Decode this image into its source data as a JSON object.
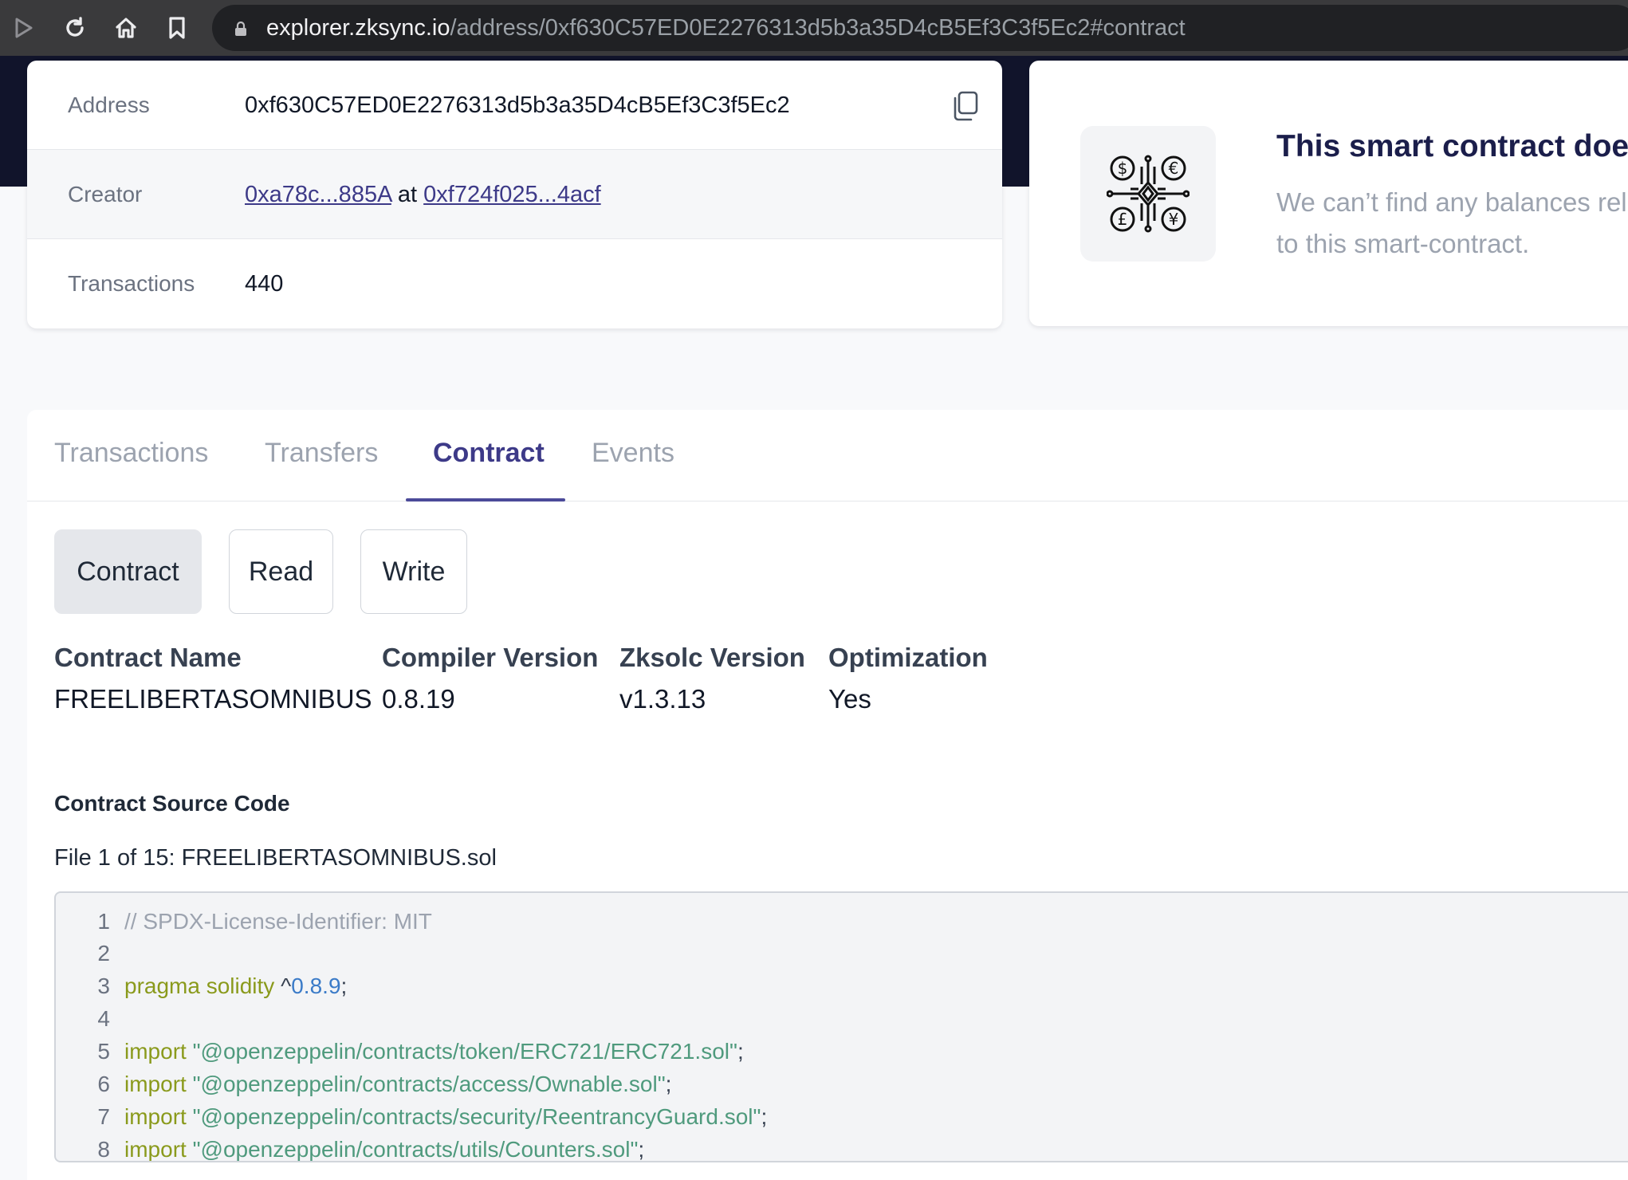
{
  "browser": {
    "url_host": "explorer.zksync.io",
    "url_path": "/address/0xf630C57ED0E2276313d5b3a35D4cB5Ef3C3f5Ec2#contract"
  },
  "info": {
    "address_label": "Address",
    "address_value": "0xf630C57ED0E2276313d5b3a35D4cB5Ef3C3f5Ec2",
    "creator_label": "Creator",
    "creator_link": "0xa78c...885A",
    "creator_at": "at",
    "creator_tx": "0xf724f025...4acf",
    "transactions_label": "Transactions",
    "transactions_value": "440"
  },
  "balances": {
    "title": "This smart contract doesn",
    "subtitle_line1": "We can’t find any balances rel",
    "subtitle_line2": "to this smart-contract."
  },
  "tabs": [
    {
      "label": "Transactions"
    },
    {
      "label": "Transfers"
    },
    {
      "label": "Contract"
    },
    {
      "label": "Events"
    }
  ],
  "active_tab": "Contract",
  "subtabs": [
    {
      "label": "Contract"
    },
    {
      "label": "Read"
    },
    {
      "label": "Write"
    }
  ],
  "contract_meta": [
    {
      "head": "Contract Name",
      "value": "FREELIBERTASOMNIBUS"
    },
    {
      "head": "Compiler Version",
      "value": "0.8.19"
    },
    {
      "head": "Zksolc Version",
      "value": "v1.3.13"
    },
    {
      "head": "Optimization",
      "value": "Yes"
    }
  ],
  "source": {
    "title": "Contract Source Code",
    "file_label": "File 1 of 15: FREELIBERTASOMNIBUS.sol",
    "lines": [
      {
        "n": "1",
        "comment": "// SPDX-License-Identifier: MIT"
      },
      {
        "n": "2"
      },
      {
        "n": "3",
        "kw": "pragma solidity",
        "plain": " ^",
        "num": "0.8.9",
        "end": ";"
      },
      {
        "n": "4"
      },
      {
        "n": "5",
        "kw": "import",
        "str": " \"@openzeppelin/contracts/token/ERC721/ERC721.sol\"",
        "end": ";"
      },
      {
        "n": "6",
        "kw": "import",
        "str": " \"@openzeppelin/contracts/access/Ownable.sol\"",
        "end": ";"
      },
      {
        "n": "7",
        "kw": "import",
        "str": " \"@openzeppelin/contracts/security/ReentrancyGuard.sol\"",
        "end": ";"
      },
      {
        "n": "8",
        "kw": "import",
        "str": " \"@openzeppelin/contracts/utils/Counters.sol\"",
        "end": ";"
      }
    ]
  },
  "colors": {
    "hero": "#11142b",
    "accent": "#3d3a88",
    "keyword": "#8a9a1c",
    "string": "#4f9a7d",
    "number": "#3b7bc8"
  }
}
